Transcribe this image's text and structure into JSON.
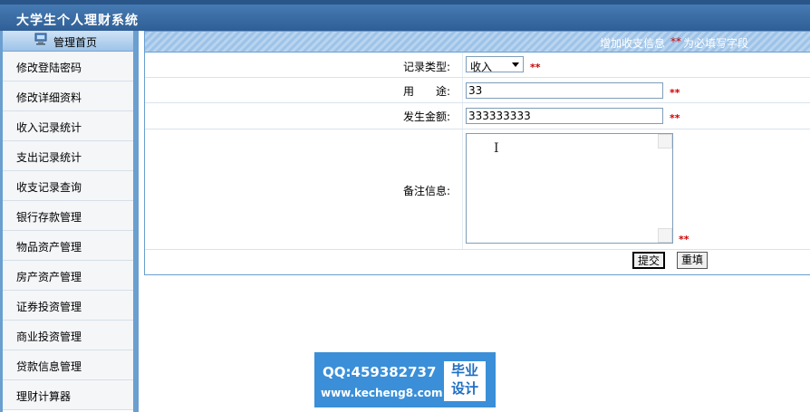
{
  "header": {
    "app_title": "大学生个人理财系统"
  },
  "sidebar": {
    "home_label": "管理首页",
    "items": [
      {
        "label": "修改登陆密码"
      },
      {
        "label": "修改详细资料"
      },
      {
        "label": "收入记录统计"
      },
      {
        "label": "支出记录统计"
      },
      {
        "label": "收支记录查询"
      },
      {
        "label": "银行存款管理"
      },
      {
        "label": "物品资产管理"
      },
      {
        "label": "房产资产管理"
      },
      {
        "label": "证券投资管理"
      },
      {
        "label": "商业投资管理"
      },
      {
        "label": "贷款信息管理"
      },
      {
        "label": "理财计算器"
      }
    ]
  },
  "form": {
    "title": "增加收支信息",
    "required_mark": "**",
    "required_note": "为必填写字段",
    "type_label": "记录类型:",
    "type_value": "收入",
    "purpose_label": "用　　途:",
    "purpose_value": "33",
    "amount_label": "发生金额:",
    "amount_value": "333333333",
    "note_label": "备注信息:",
    "note_value": "",
    "submit_label": "提交",
    "reset_label": "重填"
  },
  "watermark": {
    "qq": "QQ:459382737",
    "url": "www.kecheng8.com",
    "badge_line1": "毕业",
    "badge_line2": "设计"
  }
}
